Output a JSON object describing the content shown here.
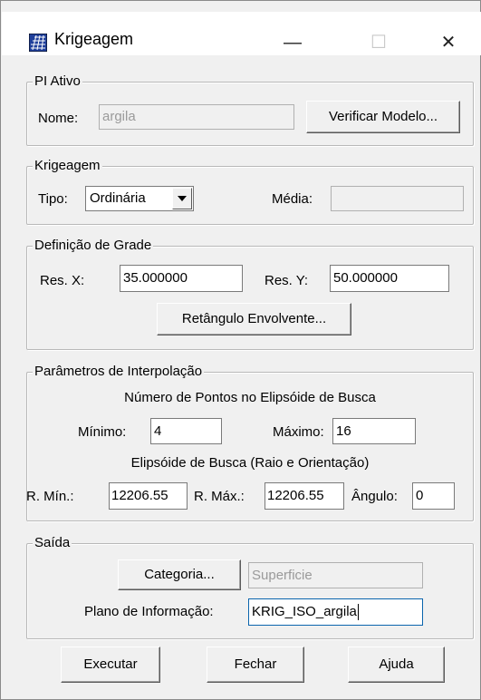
{
  "window": {
    "title": "Krigeagem",
    "minimize_glyph": "—",
    "maximize_glyph": "☐",
    "close_glyph": "✕",
    "icon": "grid-app-icon"
  },
  "pi_ativo": {
    "legend": "PI Ativo",
    "nome_label": "Nome:",
    "nome_value": "argila",
    "verificar_button": "Verificar Modelo..."
  },
  "krigeagem": {
    "legend": "Krigeagem",
    "tipo_label": "Tipo:",
    "tipo_value": "Ordinária",
    "media_label": "Média:",
    "media_value": ""
  },
  "grade": {
    "legend": "Definição de Grade",
    "resx_label": "Res. X:",
    "resx_value": "35.000000",
    "resy_label": "Res. Y:",
    "resy_value": "50.000000",
    "retangulo_button": "Retângulo Envolvente..."
  },
  "interpolacao": {
    "legend": "Parâmetros de Interpolação",
    "pontos_heading": "Número de Pontos no Elipsóide de Busca",
    "minimo_label": "Mínimo:",
    "minimo_value": "4",
    "maximo_label": "Máximo:",
    "maximo_value": "16",
    "elipsoide_heading": "Elipsóide de Busca (Raio e Orientação)",
    "rmin_label": "R. Mín.:",
    "rmin_value": "12206.55",
    "rmax_label": "R. Máx.:",
    "rmax_value": "12206.55",
    "angulo_label": "Ângulo:",
    "angulo_value": "0"
  },
  "saida": {
    "legend": "Saída",
    "categoria_button": "Categoria...",
    "categoria_value": "Superficie",
    "plano_label": "Plano de Informação:",
    "plano_value": "KRIG_ISO_argila"
  },
  "footer": {
    "executar": "Executar",
    "fechar": "Fechar",
    "ajuda": "Ajuda"
  },
  "colors": {
    "dialog_bg": "#f0f0f0",
    "focus_border": "#0a64ad",
    "icon_blue": "#1f3f9b"
  }
}
